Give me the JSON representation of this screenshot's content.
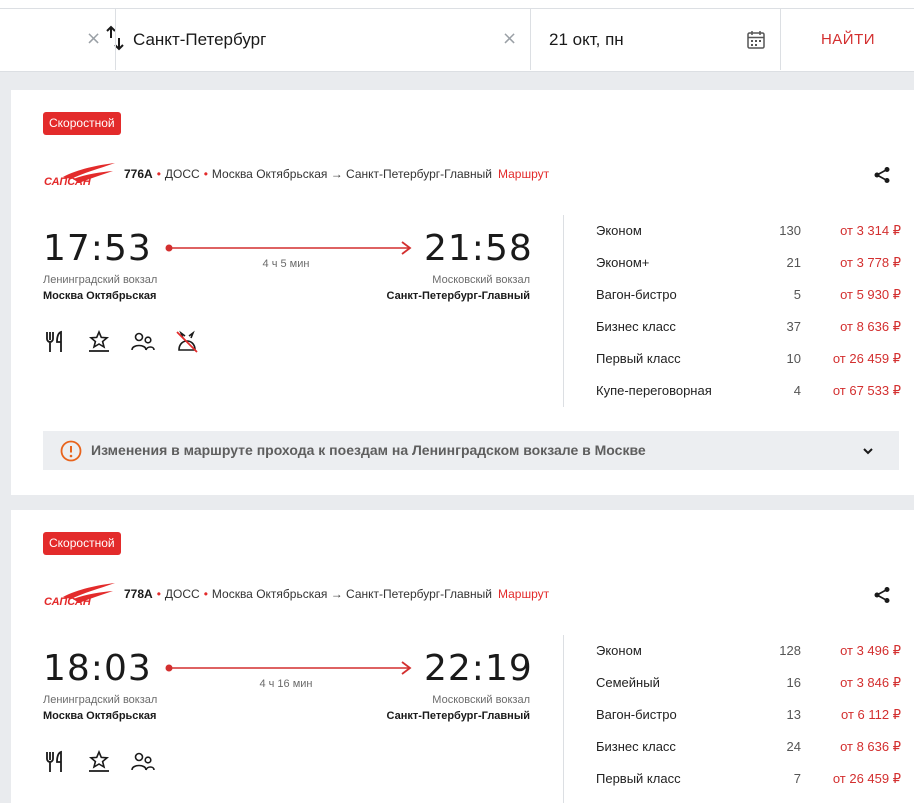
{
  "search": {
    "clear_from": "×",
    "to_value": "Санкт-Петербург",
    "clear_to": "×",
    "date_value": "21 окт, пн",
    "find_label": "НАЙТИ"
  },
  "trains": [
    {
      "badge": "Скоростной",
      "brand": "САПСАН",
      "number": "776А",
      "carrier": "ДОСС",
      "route": "Москва Октябрьская → Санкт-Петербург-Главный",
      "route_link": "Маршрут",
      "departure_time": "17:53",
      "arrival_time": "21:58",
      "duration": "4 ч 5 мин",
      "departure_station": "Ленинградский вокзал",
      "departure_city": "Москва Октябрьская",
      "arrival_station": "Московский вокзал",
      "arrival_city": "Санкт-Петербург-Главный",
      "amenities": [
        "restaurant-icon",
        "comfort-class-icon",
        "family-icon",
        "no-pets-icon"
      ],
      "classes": [
        {
          "name": "Эконом",
          "seats": "130",
          "price": "от 3 314 ₽"
        },
        {
          "name": "Эконом+",
          "seats": "21",
          "price": "от 3 778 ₽"
        },
        {
          "name": "Вагон-бистро",
          "seats": "5",
          "price": "от 5 930 ₽"
        },
        {
          "name": "Бизнес класс",
          "seats": "37",
          "price": "от 8 636 ₽"
        },
        {
          "name": "Первый класс",
          "seats": "10",
          "price": "от 26 459 ₽"
        },
        {
          "name": "Купе-переговорная",
          "seats": "4",
          "price": "от 67 533 ₽"
        }
      ],
      "notice": "Изменения в маршруте прохода к поездам на Ленинградском вокзале в Москве"
    },
    {
      "badge": "Скоростной",
      "brand": "САПСАН",
      "number": "778А",
      "carrier": "ДОСС",
      "route": "Москва Октябрьская → Санкт-Петербург-Главный",
      "route_link": "Маршрут",
      "departure_time": "18:03",
      "arrival_time": "22:19",
      "duration": "4 ч 16 мин",
      "departure_station": "Ленинградский вокзал",
      "departure_city": "Москва Октябрьская",
      "arrival_station": "Московский вокзал",
      "arrival_city": "Санкт-Петербург-Главный",
      "amenities": [
        "restaurant-icon",
        "comfort-class-icon",
        "family-icon"
      ],
      "classes": [
        {
          "name": "Эконом",
          "seats": "128",
          "price": "от 3 496 ₽"
        },
        {
          "name": "Семейный",
          "seats": "16",
          "price": "от 3 846 ₽"
        },
        {
          "name": "Вагон-бистро",
          "seats": "13",
          "price": "от 6 112 ₽"
        },
        {
          "name": "Бизнес класс",
          "seats": "24",
          "price": "от 8 636 ₽"
        },
        {
          "name": "Первый класс",
          "seats": "7",
          "price": "от 26 459 ₽"
        }
      ]
    }
  ],
  "colors": {
    "accent": "#d32f2f",
    "badge": "#e32b2b",
    "page_bg": "#e9ebee"
  }
}
